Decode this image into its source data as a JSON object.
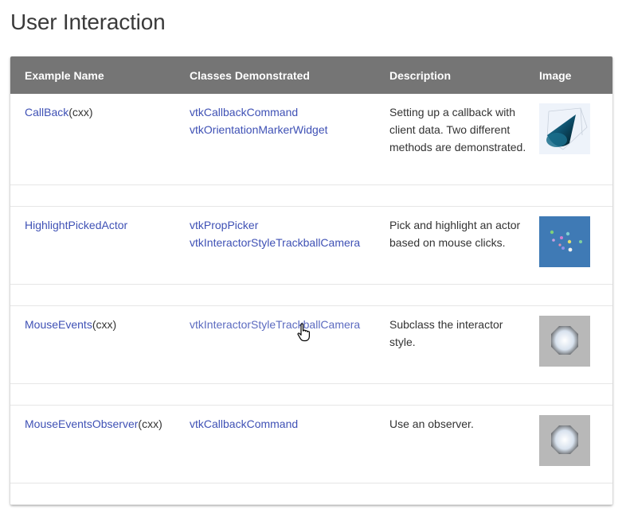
{
  "page": {
    "title": "User Interaction"
  },
  "table": {
    "headers": {
      "name": "Example Name",
      "classes": "Classes Demonstrated",
      "description": "Description",
      "image": "Image"
    },
    "rows": [
      {
        "name": "CallBack",
        "suffix": "(",
        "suffix_link": "cxx",
        "suffix_close": ")",
        "classes": [
          "vtkCallbackCommand",
          "vtkOrientationMarkerWidget"
        ],
        "description": "Setting up a callback with client data. Two different methods are demonstrated.",
        "image_icon": "cone-thumbnail-icon"
      },
      {
        "name": "HighlightPickedActor",
        "classes": [
          "vtkPropPicker",
          "vtkInteractorStyleTrackballCamera"
        ],
        "description": "Pick and highlight an actor based on mouse clicks.",
        "image_icon": "spheres-thumbnail-icon"
      },
      {
        "name": "MouseEvents",
        "suffix": "(",
        "suffix_link": "cxx",
        "suffix_close": ")",
        "classes": [
          "vtkInteractorStyleTrackballCamera"
        ],
        "description": "Subclass the interactor style.",
        "image_icon": "sphere-thumbnail-icon"
      },
      {
        "name": "MouseEventsObserver",
        "suffix": "(",
        "suffix_link": "cxx",
        "suffix_close": ")",
        "classes": [
          "vtkCallbackCommand"
        ],
        "description": "Use an observer.",
        "image_icon": "sphere-thumbnail-icon"
      }
    ]
  },
  "colors": {
    "header_bg": "#757575",
    "link": "#3f51b5"
  }
}
